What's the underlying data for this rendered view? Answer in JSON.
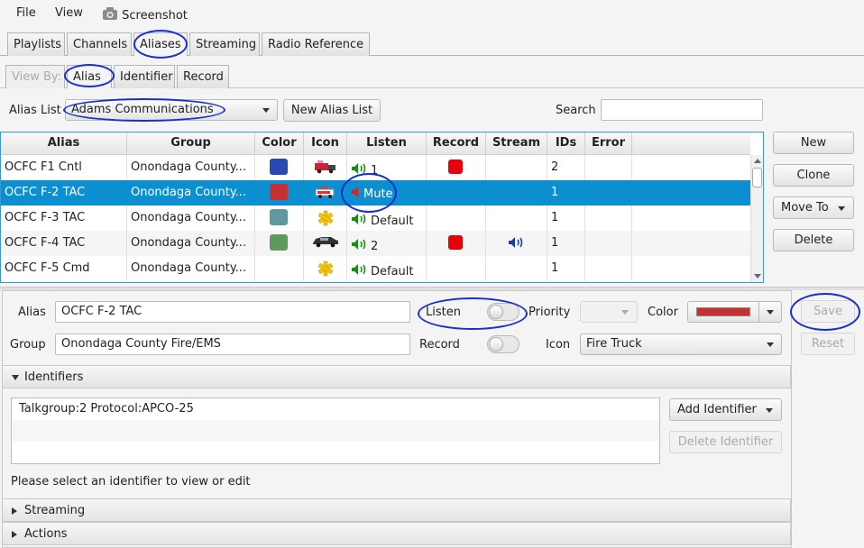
{
  "menu": {
    "file": "File",
    "view": "View",
    "screenshot": "Screenshot"
  },
  "tabs": [
    "Playlists",
    "Channels",
    "Aliases",
    "Streaming",
    "Radio Reference"
  ],
  "viewby": {
    "label": "View By:",
    "tabs": [
      "Alias",
      "Identifier",
      "Record"
    ]
  },
  "alias_list": {
    "label": "Alias List",
    "value": "Adams Communications",
    "new_button": "New Alias List",
    "search_label": "Search",
    "search_value": ""
  },
  "table": {
    "columns": [
      "Alias",
      "Group",
      "Color",
      "Icon",
      "Listen",
      "Record",
      "Stream",
      "IDs",
      "Error"
    ],
    "rows": [
      {
        "alias": "OCFC F1 Cntl",
        "group": "Onondaga County...",
        "color": "#2a49b0",
        "icon": "truck-icon",
        "listen": "1",
        "record": true,
        "stream": false,
        "ids": "2",
        "selected": false
      },
      {
        "alias": "OCFC F-2 TAC",
        "group": "Onondaga County...",
        "color": "#c53030",
        "icon": "fire-truck-icon",
        "listen": "Mute",
        "record": false,
        "stream": false,
        "ids": "1",
        "selected": true
      },
      {
        "alias": "OCFC F-3 TAC",
        "group": "Onondaga County...",
        "color": "#5f98a0",
        "icon": "star-of-life-icon",
        "listen": "Default",
        "record": false,
        "stream": false,
        "ids": "1",
        "selected": false
      },
      {
        "alias": "OCFC F-4 TAC",
        "group": "Onondaga County...",
        "color": "#5e9a60",
        "icon": "car-icon",
        "listen": "2",
        "record": true,
        "stream": true,
        "ids": "1",
        "selected": false
      },
      {
        "alias": "OCFC F-5 Cmd",
        "group": "Onondaga County...",
        "color": "",
        "icon": "star-of-life-icon",
        "listen": "Default",
        "record": false,
        "stream": false,
        "ids": "1",
        "selected": false
      }
    ]
  },
  "side_buttons": {
    "new": "New",
    "clone": "Clone",
    "move_to": "Move To",
    "delete": "Delete"
  },
  "editor": {
    "alias_label": "Alias",
    "alias_value": "OCFC F-2 TAC",
    "group_label": "Group",
    "group_value": "Onondaga County Fire/EMS",
    "listen_label": "Listen",
    "record_label": "Record",
    "priority_label": "Priority",
    "color_label": "Color",
    "color_value": "#c53030",
    "icon_label": "Icon",
    "icon_value": "Fire Truck",
    "save": "Save",
    "reset": "Reset"
  },
  "identifiers": {
    "title": "Identifiers",
    "items": [
      "Talkgroup:2 Protocol:APCO-25"
    ],
    "add": "Add Identifier",
    "delete": "Delete Identifier",
    "hint": "Please select an identifier to view or edit"
  },
  "sections": {
    "streaming": "Streaming",
    "actions": "Actions"
  }
}
